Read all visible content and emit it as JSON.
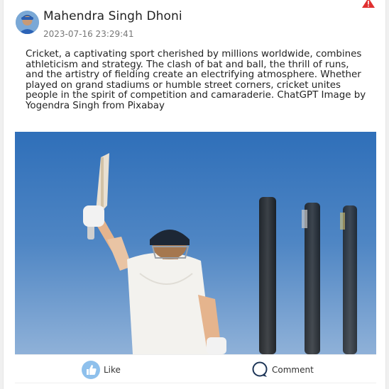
{
  "post": {
    "author_name": "Mahendra Singh Dhoni",
    "timestamp": "2023-07-16 23:29:41",
    "body_text": "Cricket, a captivating sport cherished by millions worldwide, combines athleticism and strategy. The clash of bat and ball, the thrill of runs, and the artistry of fielding create an electrifying atmosphere. Whether played on grand stadiums or humble street corners, cricket unites people in the spirit of competition and camaraderie. ChatGPT Image by Yogendra Singh from Pixabay"
  },
  "actions": {
    "like_label": "Like",
    "comment_label": "Comment"
  },
  "icons": {
    "warning": "warning-icon",
    "like": "thumbs-up-icon",
    "comment": "comment-bubble-icon"
  },
  "colors": {
    "sky": "#4f86c4",
    "like_icon_bg": "#8ec0ec",
    "warning": "#e03030",
    "comment_icon": "#1d3557"
  }
}
